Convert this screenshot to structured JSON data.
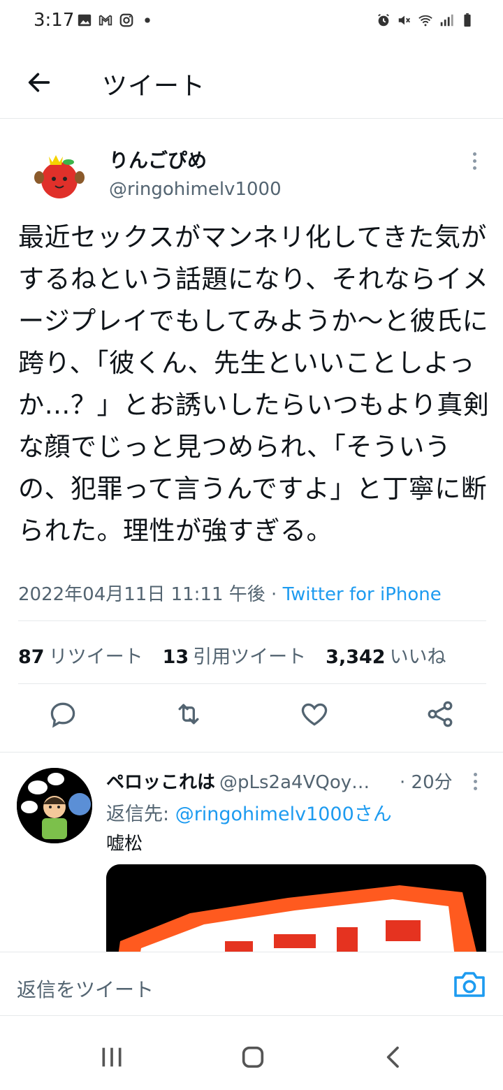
{
  "status_bar": {
    "time": "3:17",
    "left_icons": [
      "image-icon",
      "gmail-icon",
      "instagram-icon",
      "dot-icon"
    ],
    "right_icons": [
      "alarm-icon",
      "mute-icon",
      "wifi-icon",
      "signal-icon",
      "battery-icon"
    ]
  },
  "header": {
    "title": "ツイート"
  },
  "tweet": {
    "author_name": "りんごぴめ",
    "author_handle": "@ringohimelv1000",
    "text": "最近セックスがマンネリ化してきた気がするねという話題になり、それならイメージプレイでもしてみようか〜と彼氏に跨り、「彼くん、先生といいことしよっか…？」とお誘いしたらいつもより真剣な顔でじっと見つめられ、「そういうの、犯罪って言うんですよ」と丁寧に断られた。理性が強すぎる。",
    "timestamp": "2022年04月11日 11:11 午後",
    "separator": " · ",
    "source": "Twitter for iPhone",
    "stats": {
      "retweets": "87",
      "retweets_label": "リツイート",
      "quotes": "13",
      "quotes_label": "引用ツイート",
      "likes": "3,342",
      "likes_label": "いいね"
    }
  },
  "reply": {
    "name": "ペロッこれは",
    "handle": "@pLs2a4VQoy…",
    "time": "· 20分",
    "reply_to_label": "返信先: ",
    "reply_to_handle": "@ringohimelv1000さん",
    "body": "嘘松"
  },
  "composer": {
    "placeholder": "返信をツイート"
  },
  "colors": {
    "accent": "#1d9bf0",
    "secondary_text": "#536471",
    "primary_text": "#0f1419",
    "divider": "#e6e9eb"
  }
}
